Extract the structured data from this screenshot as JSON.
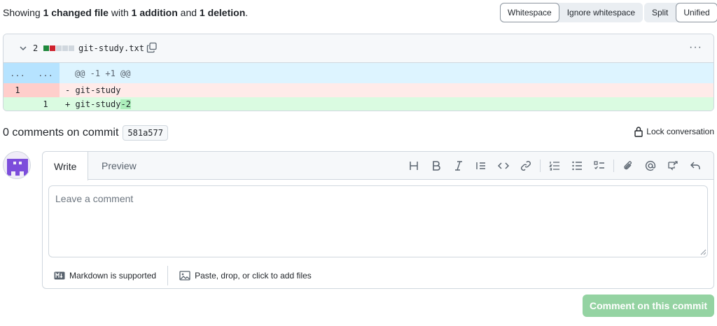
{
  "summary": {
    "prefix": "Showing ",
    "files": "1 changed file",
    "mid1": " with ",
    "additions": "1 addition",
    "mid2": " and ",
    "deletions": "1 deletion",
    "suffix": "."
  },
  "toolbar": {
    "whitespace": "Whitespace",
    "ignore_whitespace": "Ignore whitespace",
    "split": "Split",
    "unified": "Unified"
  },
  "file": {
    "change_count": "2",
    "name": "git-study.txt",
    "menu": "···",
    "hunk_left": "...",
    "hunk_right": "...",
    "hunk_header": "@@ -1 +1 @@",
    "del_line_no": "1",
    "del_code": "- git-study",
    "add_line_no": "1",
    "add_code_base": "+ git-study",
    "add_code_highlight": "-2"
  },
  "comments": {
    "title": "0 comments on commit",
    "sha": "581a577",
    "lock_label": "Lock conversation"
  },
  "editor": {
    "tab_write": "Write",
    "tab_preview": "Preview",
    "placeholder": "Leave a comment",
    "markdown_label": "Markdown is supported",
    "attach_label": "Paste, drop, or click to add files",
    "submit_label": "Comment on this commit"
  },
  "colors": {
    "addition": "#1f883d",
    "deletion": "#cf222e",
    "hunk_bg": "#ddf4ff",
    "submit_disabled": "#94d3a2"
  }
}
